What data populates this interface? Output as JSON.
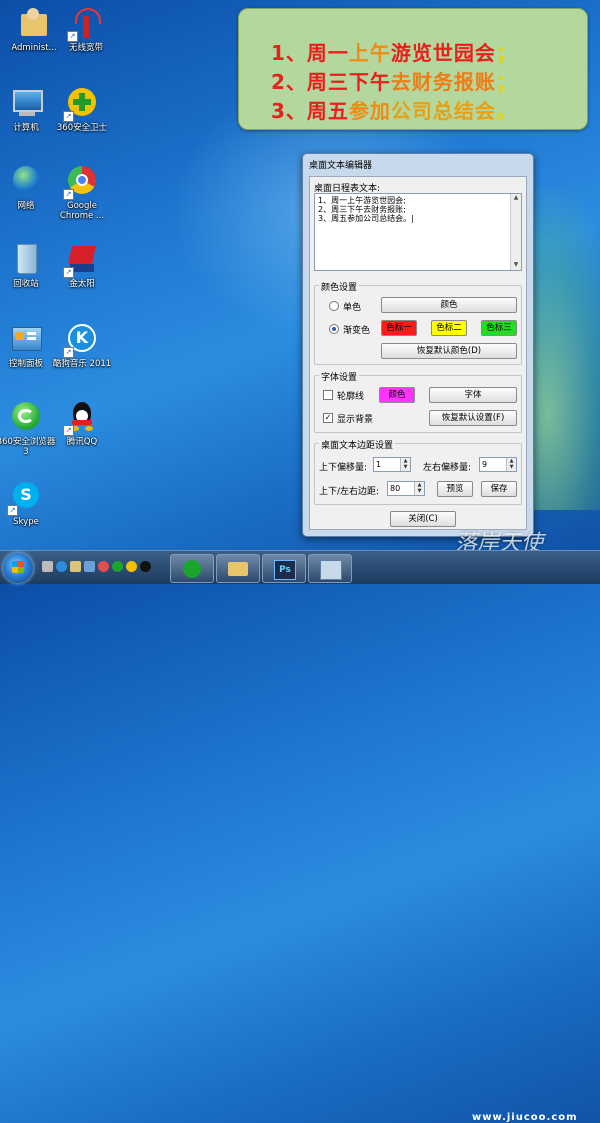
{
  "desktop": {
    "icons": [
      {
        "label": "Administ...",
        "icon": "user-folder-icon"
      },
      {
        "label": "无线宽带",
        "icon": "wireless-icon"
      },
      {
        "label": "计算机",
        "icon": "computer-icon"
      },
      {
        "label": "360安全卫士",
        "icon": "360-guard-icon"
      },
      {
        "label": "网络",
        "icon": "network-icon"
      },
      {
        "label": "Google Chrome ...",
        "icon": "chrome-icon"
      },
      {
        "label": "回收站",
        "icon": "recycle-bin-icon"
      },
      {
        "label": "金太阳",
        "icon": "sun-app-icon"
      },
      {
        "label": "控制面板",
        "icon": "control-panel-icon"
      },
      {
        "label": "酷狗音乐 2011",
        "icon": "kugou-icon"
      },
      {
        "label": "360安全浏览器 3",
        "icon": "360-browser-icon"
      },
      {
        "label": "腾讯QQ",
        "icon": "qq-icon"
      },
      {
        "label": "Skype",
        "icon": "skype-icon"
      }
    ],
    "colors": {
      "note_bg": "#b3d79d",
      "red": "#e8201c",
      "orange": "#ef8b15",
      "yellow": "#e6d400"
    }
  },
  "note": {
    "lines": [
      [
        "1、周一",
        "上午",
        "游览世园会",
        "；"
      ],
      [
        "2、周三",
        "下午",
        "去财务报账",
        "；"
      ],
      [
        "3、周五",
        "参加",
        "公司总结会",
        "。"
      ]
    ]
  },
  "dialog": {
    "title": "桌面文本编辑器",
    "schedule_label": "桌面日程表文本:",
    "schedule_lines": [
      "1、周一上午游览世园会;",
      "2、周三下午去财务报账;",
      "3、周五参加公司总结会。|"
    ],
    "color_group": {
      "title": "颜色设置",
      "single_label": "单色",
      "color_button": "颜色",
      "gradient_label": "渐变色",
      "color1": "色标一",
      "color2": "色标二",
      "color3": "色标三",
      "color1_bg": "#ff1a1a",
      "color2_bg": "#ffff00",
      "color3_bg": "#22dd22",
      "reset_button": "恢复默认颜色(D)"
    },
    "font_group": {
      "title": "字体设置",
      "outline_label": "轮廓线",
      "outline_color_button": "颜色",
      "outline_color_bg": "#ff33ff",
      "font_button": "字体",
      "show_bg_label": "显示背景",
      "reset_button": "恢复默认设置(F)"
    },
    "margin_group": {
      "title": "桌面文本边距设置",
      "vertical_label": "上下偏移量:",
      "vertical_value": "1",
      "horizontal_label": "左右偏移量:",
      "horizontal_value": "9",
      "margin_label": "上下/左右边距:",
      "margin_value": "80",
      "preview_button": "预览",
      "save_button": "保存"
    },
    "close_button": "关闭(C)"
  },
  "taskbar": {
    "tray_time": "",
    "watermark": "落岸天使",
    "watermark_url": "www.jiucoo.com"
  }
}
